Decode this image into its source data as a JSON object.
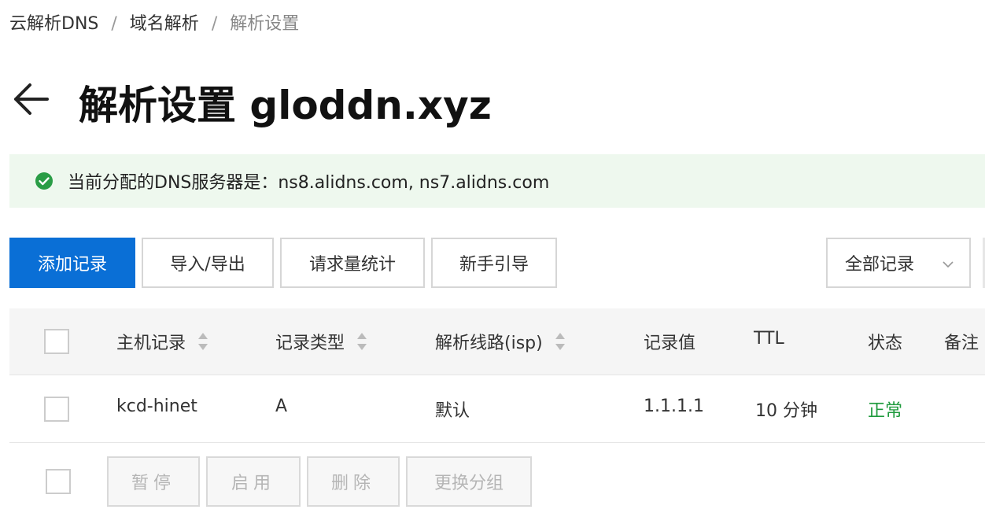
{
  "breadcrumb": {
    "items": [
      "云解析DNS",
      "域名解析",
      "解析设置"
    ],
    "separator": "/"
  },
  "header": {
    "title": "解析设置 gloddn.xyz"
  },
  "alert": {
    "message": "当前分配的DNS服务器是：ns8.alidns.com, ns7.alidns.com",
    "icon": "check-circle-icon",
    "color": "#2a9d46"
  },
  "toolbar": {
    "add_label": "添加记录",
    "import_export_label": "导入/导出",
    "stats_label": "请求量统计",
    "guide_label": "新手引导",
    "filter_selected": "全部记录",
    "primary_color": "#0a6fd6"
  },
  "table": {
    "headers": {
      "host": "主机记录",
      "type": "记录类型",
      "line": "解析线路(isp)",
      "value": "记录值",
      "ttl": "TTL",
      "status": "状态",
      "remark": "备注"
    },
    "rows": [
      {
        "host": "kcd-hinet",
        "type": "A",
        "line": "默认",
        "value": "1.1.1.1",
        "ttl": "10 分钟",
        "status": "正常"
      }
    ],
    "status_color": "#1e9a3c"
  },
  "batch": {
    "pause_label": "暂停",
    "enable_label": "启用",
    "delete_label": "删除",
    "change_group_label": "更换分组"
  }
}
